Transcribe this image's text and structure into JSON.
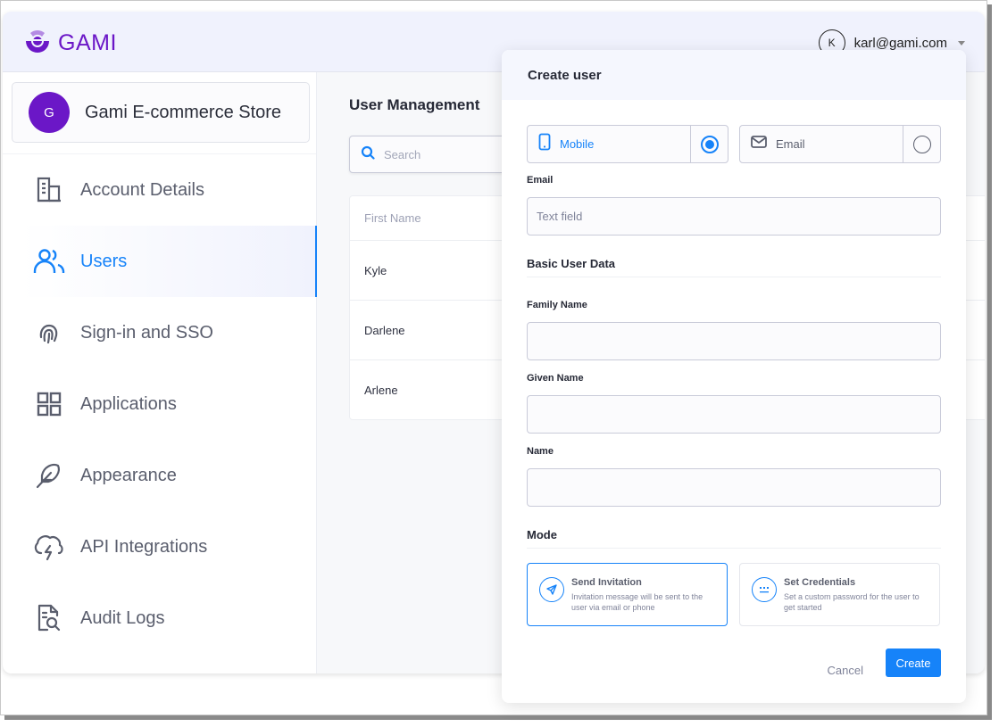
{
  "header": {
    "logo_text": "GAMI",
    "user_initial": "K",
    "user_email": "karl@gami.com"
  },
  "sidebar": {
    "org": {
      "initial": "G",
      "name": "Gami E-commerce Store"
    },
    "items": [
      {
        "label": "Account Details",
        "icon": "building-icon",
        "active": false
      },
      {
        "label": "Users",
        "icon": "users-icon",
        "active": true
      },
      {
        "label": "Sign-in and SSO",
        "icon": "fingerprint-icon",
        "active": false
      },
      {
        "label": "Applications",
        "icon": "grid-icon",
        "active": false
      },
      {
        "label": "Appearance",
        "icon": "feather-icon",
        "active": false
      },
      {
        "label": "API Integrations",
        "icon": "cloud-lightning-icon",
        "active": false
      },
      {
        "label": "Audit Logs",
        "icon": "file-search-icon",
        "active": false
      }
    ]
  },
  "main": {
    "title": "User Management",
    "search": {
      "placeholder": "Search",
      "value": ""
    },
    "table": {
      "columns": [
        "First Name"
      ],
      "rows": [
        {
          "first_name": "Kyle"
        },
        {
          "first_name": "Darlene"
        },
        {
          "first_name": "Arlene"
        }
      ]
    }
  },
  "modal": {
    "title": "Create user",
    "contact_toggle": {
      "options": [
        {
          "label": "Mobile",
          "icon": "mobile-icon",
          "selected": true
        },
        {
          "label": "Email",
          "icon": "mail-icon",
          "selected": false
        }
      ]
    },
    "email": {
      "label": "Email",
      "placeholder": "Text field",
      "value": ""
    },
    "basic_section": "Basic User Data",
    "family_name": {
      "label": "Family Name",
      "value": ""
    },
    "given_name": {
      "label": "Given Name",
      "value": ""
    },
    "name": {
      "label": "Name",
      "value": ""
    },
    "mode_section": "Mode",
    "modes": [
      {
        "title": "Send Invitation",
        "description": "Invitation message will be sent to the user via email or phone",
        "icon": "send-icon",
        "selected": true
      },
      {
        "title": "Set Credentials",
        "description": "Set a custom password for the user to get started",
        "icon": "password-icon",
        "selected": false
      }
    ],
    "cancel_label": "Cancel",
    "create_label": "Create"
  },
  "colors": {
    "brand": "#6b17c7",
    "accent": "#1683f9",
    "text_primary": "#262936",
    "text_muted": "#5a5e6d"
  }
}
